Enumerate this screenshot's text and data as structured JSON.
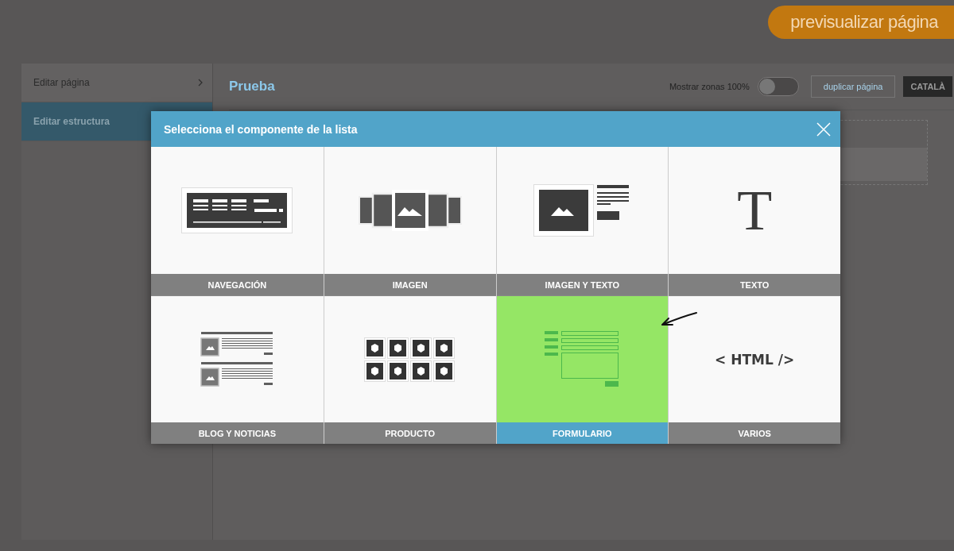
{
  "preview_button": {
    "label": "previsualizar página"
  },
  "sidebar": {
    "items": [
      {
        "label": "Editar página",
        "selected": false
      },
      {
        "label": "Editar estructura",
        "selected": true
      }
    ]
  },
  "page": {
    "title": "Prueba",
    "zones_label": "Mostrar zonas 100%",
    "zones_toggle_on": false,
    "duplicate_button": "duplicar página",
    "language_button": "CATALÀ"
  },
  "modal": {
    "title": "Selecciona el componente de la lista",
    "tiles": [
      {
        "label": "NAVEGACIÓN",
        "kind": "navigation",
        "selected": false
      },
      {
        "label": "IMAGEN",
        "kind": "gallery",
        "selected": false
      },
      {
        "label": "IMAGEN Y TEXTO",
        "kind": "image-text",
        "selected": false
      },
      {
        "label": "TEXTO",
        "kind": "text",
        "glyph": "T",
        "selected": false
      },
      {
        "label": "BLOG Y NOTICIAS",
        "kind": "blog",
        "selected": false
      },
      {
        "label": "PRODUCTO",
        "kind": "product",
        "selected": false
      },
      {
        "label": "FORMULARIO",
        "kind": "form",
        "selected": true
      },
      {
        "label": "VARIOS",
        "kind": "html",
        "glyph": "< HTML />",
        "selected": false
      }
    ]
  }
}
